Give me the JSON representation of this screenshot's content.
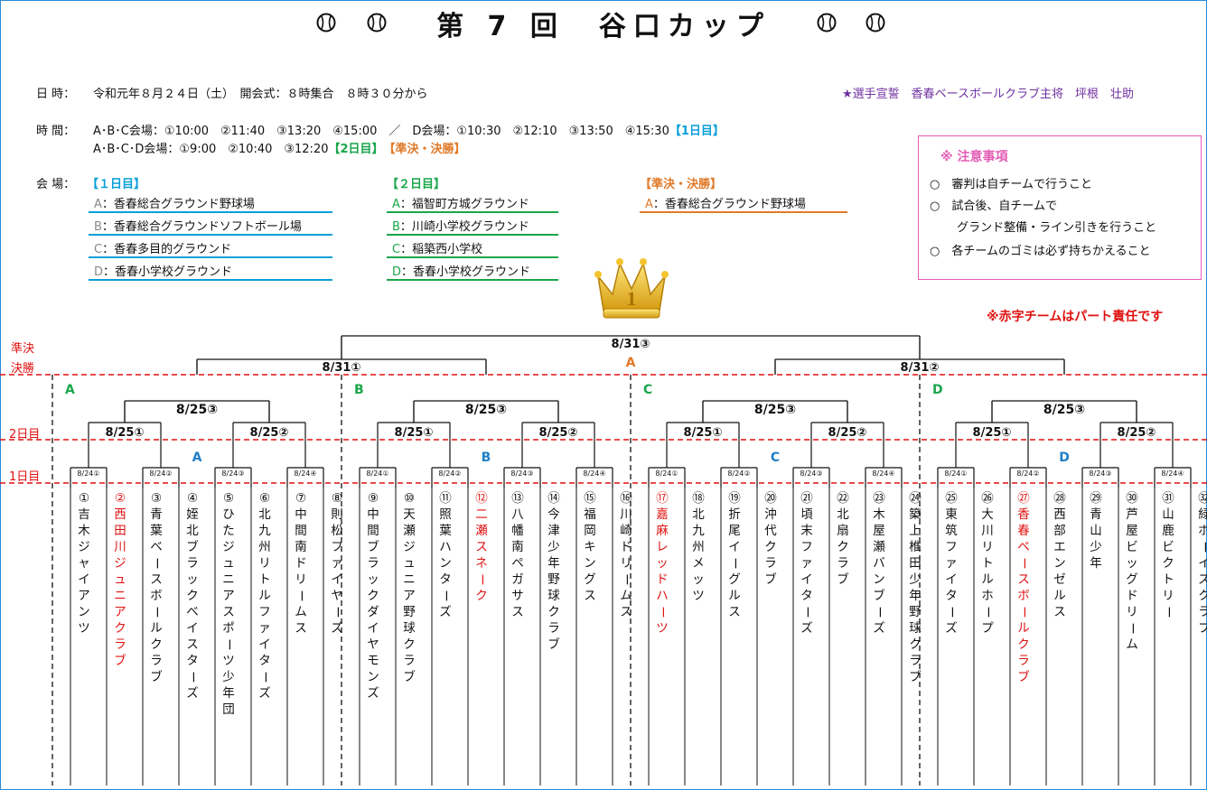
{
  "title": "第 7 回　谷口カップ",
  "ball_icon": "baseball-icon",
  "info": {
    "date_label": "日 時：",
    "date_text": "令和元年８月２４日（土）　開会式：８時集合　８時３０分から",
    "oath": "★選手宣誓　香春ベースボールクラブ主将　坪根　壮助",
    "time_label": "時 間：",
    "time_line1": "A･B･C会場：①10:00　②11:40　③13:20　④15:00　／　D会場：①10:30　②12:10　③13:50　④15:30",
    "time_line1_tag": "【1日目】",
    "time_line2": "A･B･C･D会場：①9:00　②10:40　③12:20",
    "time_line2_tag_day2": "【2日目】",
    "time_line2_tag_final": "【準決・決勝】",
    "venue_label": "会 場：",
    "day1_head": "【１日目】",
    "day2_head": "【２日目】",
    "final_head": "【準決・決勝】",
    "day1_venues": [
      {
        "k": "A",
        "v": "：香春総合グラウンド野球場"
      },
      {
        "k": "B",
        "v": "：香春総合グラウンドソフトボール場"
      },
      {
        "k": "C",
        "v": "：香春多目的グラウンド"
      },
      {
        "k": "D",
        "v": "：香春小学校グラウンド"
      }
    ],
    "day2_venues": [
      {
        "k": "A",
        "v": "：福智町方城グラウンド"
      },
      {
        "k": "B",
        "v": "：川崎小学校グラウンド"
      },
      {
        "k": "C",
        "v": "：稲築西小学校"
      },
      {
        "k": "D",
        "v": "：香春小学校グラウンド"
      }
    ],
    "final_venues": [
      {
        "k": "A",
        "v": "：香春総合グラウンド野球場"
      }
    ]
  },
  "notice": {
    "heading": "※ 注意事項",
    "items": [
      "○　審判は自チームで行うこと",
      "○　試合後、自チームで",
      "　　 グランド整備・ライン引きを行うこと",
      "○　各チームのゴミは必ず持ちかえること"
    ]
  },
  "red_note": "※赤字チームはパート責任です",
  "row_labels": {
    "semi": "準決",
    "final": "決勝",
    "day2": "2日目",
    "day1": "1日目"
  },
  "colors": {
    "day1": "#0aa0d8",
    "day2": "#1aa64a",
    "final": "#e07a2a",
    "red": "#e01010",
    "notice": "#e35bb4",
    "block": "#1aa64a",
    "sub": "#1f7ec4"
  },
  "bracket": {
    "final_date": "8/31③",
    "final_venue": "A",
    "semi_dates": [
      "8/31①",
      "8/31②"
    ],
    "blocks": [
      "A",
      "B",
      "C",
      "D"
    ],
    "block_qf_date": "8/25③",
    "day2_dates": [
      "8/25①",
      "8/25②"
    ],
    "day1_dates": [
      "8/24①",
      "8/24②",
      "8/24③",
      "8/24④"
    ]
  },
  "teams": [
    {
      "n": "①",
      "name": "吉木ジャイアンツ",
      "red": false
    },
    {
      "n": "②",
      "name": "西田川ジュニアクラブ",
      "red": true
    },
    {
      "n": "③",
      "name": "青葉ベースボールクラブ",
      "red": false
    },
    {
      "n": "④",
      "name": "姪北ブラックベイスターズ",
      "red": false
    },
    {
      "n": "⑤",
      "name": "ひたジュニアスポーツ少年団",
      "red": false
    },
    {
      "n": "⑥",
      "name": "北九州リトルファイターズ",
      "red": false
    },
    {
      "n": "⑦",
      "name": "中間南ドリームス",
      "red": false
    },
    {
      "n": "⑧",
      "name": "則松ファイヤーズ",
      "red": false
    },
    {
      "n": "⑨",
      "name": "中間ブラックダイヤモンズ",
      "red": false
    },
    {
      "n": "⑩",
      "name": "天瀬ジュニア野球クラブ",
      "red": false
    },
    {
      "n": "⑪",
      "name": "照葉ハンターズ",
      "red": false
    },
    {
      "n": "⑫",
      "name": "二瀬スネーク",
      "red": true
    },
    {
      "n": "⑬",
      "name": "八幡南ペガサス",
      "red": false
    },
    {
      "n": "⑭",
      "name": "今津少年野球クラブ",
      "red": false
    },
    {
      "n": "⑮",
      "name": "福岡キングス",
      "red": false
    },
    {
      "n": "⑯",
      "name": "川崎ドリームス",
      "red": false
    },
    {
      "n": "⑰",
      "name": "嘉麻レッドハーツ",
      "red": true
    },
    {
      "n": "⑱",
      "name": "北九州メッツ",
      "red": false
    },
    {
      "n": "⑲",
      "name": "折尾イーグルス",
      "red": false
    },
    {
      "n": "⑳",
      "name": "沖代クラブ",
      "red": false
    },
    {
      "n": "㉑",
      "name": "頃末ファイターズ",
      "red": false
    },
    {
      "n": "㉒",
      "name": "北扇クラブ",
      "red": false
    },
    {
      "n": "㉓",
      "name": "木屋瀬バンブーズ",
      "red": false
    },
    {
      "n": "㉔",
      "name": "築上椎田少年野球クラブ",
      "red": false
    },
    {
      "n": "㉕",
      "name": "東筑ファイターズ",
      "red": false
    },
    {
      "n": "㉖",
      "name": "大川リトルホープ",
      "red": false
    },
    {
      "n": "㉗",
      "name": "香春ベースボールクラブ",
      "red": true
    },
    {
      "n": "㉘",
      "name": "西部エンゼルス",
      "red": false
    },
    {
      "n": "㉙",
      "name": "青山少年",
      "red": false
    },
    {
      "n": "㉚",
      "name": "芦屋ビッグドリーム",
      "red": false
    },
    {
      "n": "㉛",
      "name": "山鹿ビクトリー",
      "red": false
    },
    {
      "n": "㉜",
      "name": "緑ボーイズクラブ",
      "red": false
    }
  ]
}
